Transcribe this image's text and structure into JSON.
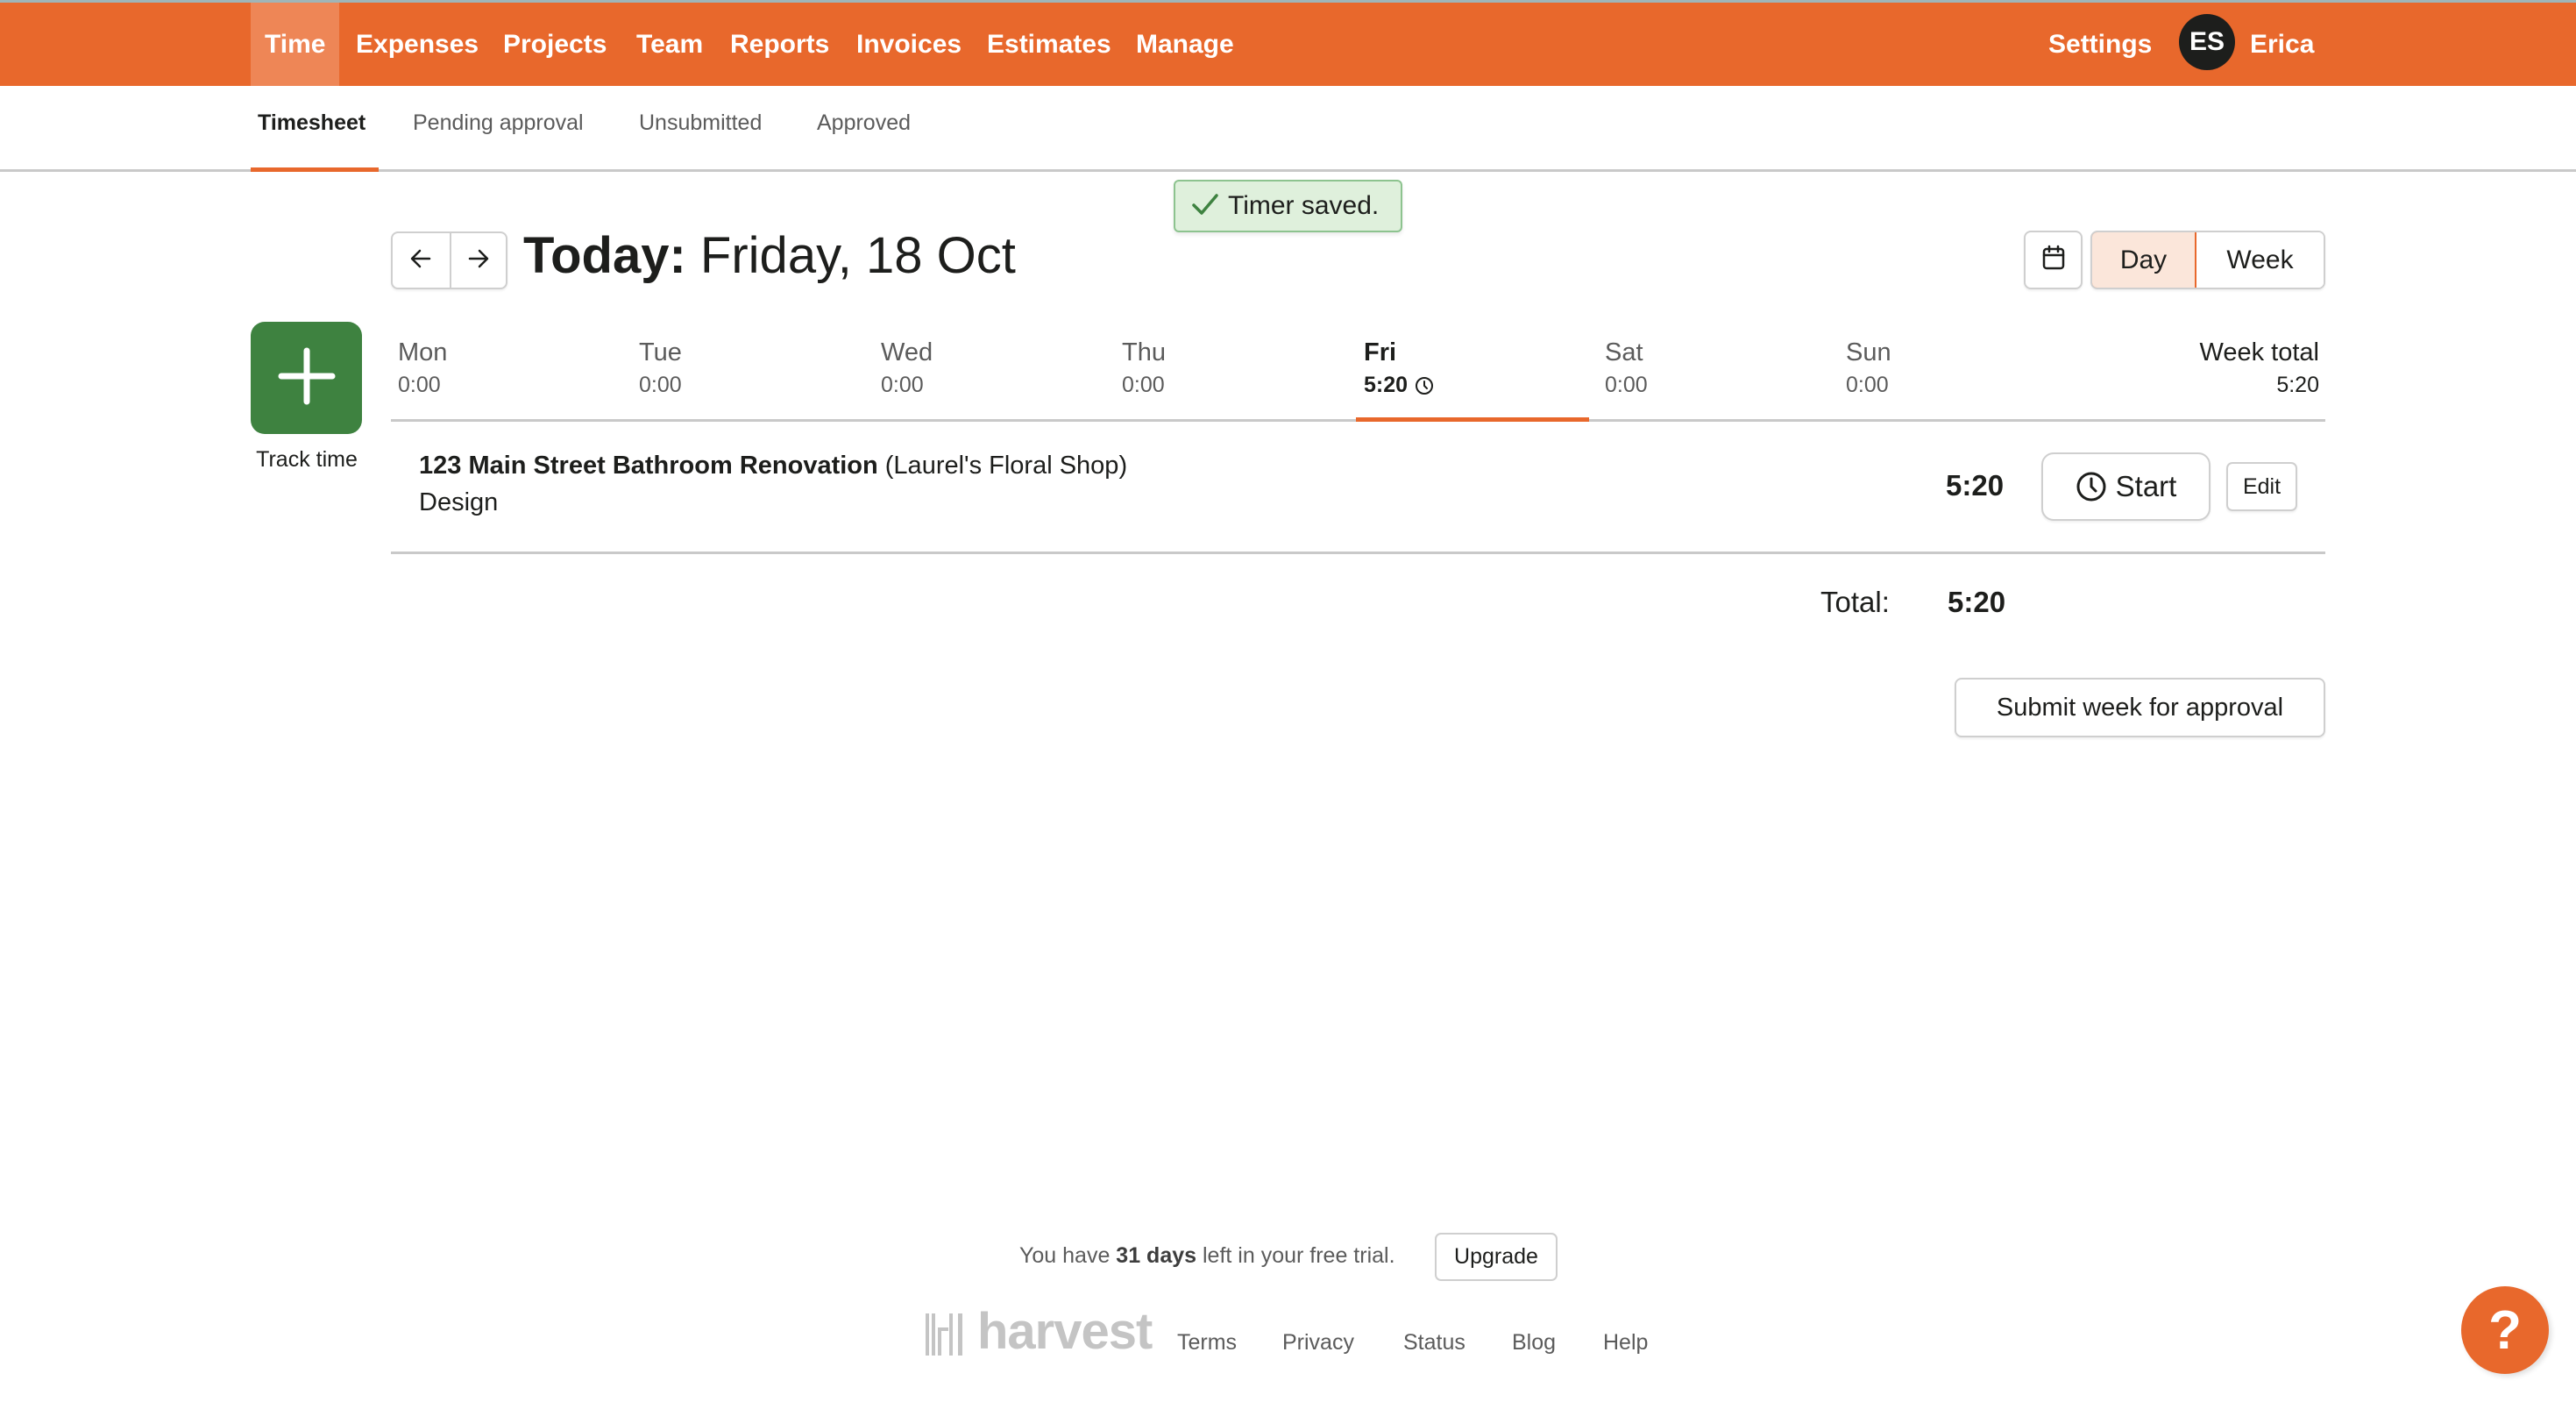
{
  "nav": {
    "items": [
      {
        "label": "Time",
        "active": true
      },
      {
        "label": "Expenses"
      },
      {
        "label": "Projects"
      },
      {
        "label": "Team"
      },
      {
        "label": "Reports"
      },
      {
        "label": "Invoices"
      },
      {
        "label": "Estimates"
      },
      {
        "label": "Manage"
      }
    ],
    "settings_label": "Settings",
    "user_initials": "ES",
    "user_name": "Erica"
  },
  "subnav": {
    "items": [
      {
        "label": "Timesheet",
        "active": true
      },
      {
        "label": "Pending approval"
      },
      {
        "label": "Unsubmitted"
      },
      {
        "label": "Approved"
      }
    ]
  },
  "toast": {
    "message": "Timer saved.",
    "icon": "check-icon"
  },
  "header": {
    "prev_icon": "arrow-left-icon",
    "next_icon": "arrow-right-icon",
    "title_prefix": "Today:",
    "title_date": " Friday, 18 Oct",
    "calendar_icon": "calendar-icon",
    "view_options": [
      "Day",
      "Week"
    ],
    "selected_view": "Day"
  },
  "track_time": {
    "label": "Track time",
    "icon": "plus-icon"
  },
  "days": [
    {
      "name": "Mon",
      "hours": "0:00"
    },
    {
      "name": "Tue",
      "hours": "0:00"
    },
    {
      "name": "Wed",
      "hours": "0:00"
    },
    {
      "name": "Thu",
      "hours": "0:00"
    },
    {
      "name": "Fri",
      "hours": "5:20",
      "active": true,
      "running_icon": "clock-icon"
    },
    {
      "name": "Sat",
      "hours": "0:00"
    },
    {
      "name": "Sun",
      "hours": "0:00"
    }
  ],
  "week_total": {
    "label": "Week total",
    "hours": "5:20"
  },
  "entries": [
    {
      "project": "123 Main Street Bathroom Renovation",
      "client": " (Laurel's Floral Shop)",
      "task": "Design",
      "hours": "5:20",
      "start_label": "Start",
      "edit_label": "Edit"
    }
  ],
  "total": {
    "label": "Total:",
    "hours": "5:20"
  },
  "submit_label": "Submit week for approval",
  "footer": {
    "trial_prefix": "You have ",
    "trial_days": "31 days",
    "trial_suffix": " left in your free trial.",
    "upgrade_label": "Upgrade",
    "logo_text": "harvest",
    "links": [
      "Terms",
      "Privacy",
      "Status",
      "Blog",
      "Help"
    ]
  },
  "help_button": {
    "label": "?"
  },
  "colors": {
    "brand": "#e8682c",
    "nav_active": "#ee8656",
    "track_green": "#3e8240",
    "toast_bg": "#dff0dc",
    "toast_border": "#8dc38f",
    "day_selected_bg": "#fbe6da"
  }
}
